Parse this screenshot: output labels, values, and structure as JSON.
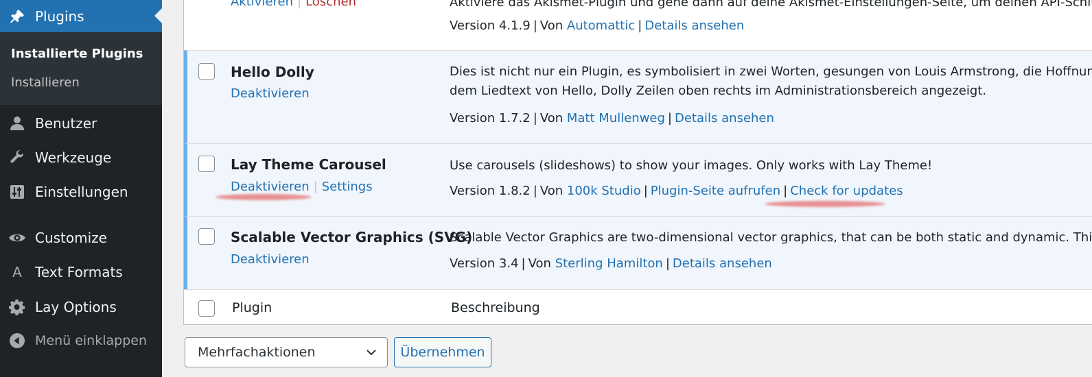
{
  "sidebar": {
    "active_menu": "Plugins",
    "submenu": [
      "Installierte Plugins",
      "Installieren"
    ],
    "items": [
      {
        "label": "Benutzer",
        "icon": "user-icon"
      },
      {
        "label": "Werkzeuge",
        "icon": "wrench-icon"
      },
      {
        "label": "Einstellungen",
        "icon": "settings-sliders-icon"
      },
      {
        "label": "Customize",
        "icon": "eye-icon"
      },
      {
        "label": "Text Formats",
        "icon": "letter-a-icon"
      },
      {
        "label": "Lay Options",
        "icon": "gear-icon"
      },
      {
        "label": "Menü einklappen",
        "icon": "collapse-arrow-icon"
      }
    ]
  },
  "plugins": [
    {
      "actions": [
        "Aktivieren",
        "Löschen"
      ],
      "desc": [
        "Aktiviere das Akismet-Plugin und gehe dann auf deine Akismet-Einstellungen-Seite, um deinen API-Schlüssel einzurichten."
      ],
      "version": "Version 4.1.9",
      "by": "Von",
      "author": "Automattic",
      "links": [
        "Details ansehen"
      ]
    },
    {
      "name": "Hello Dolly",
      "actions": [
        "Deaktivieren"
      ],
      "desc": [
        "Dies ist nicht nur ein Plugin, es symbolisiert in zwei Worten, gesungen von Louis Armstrong, die Hoffnung und die Begeisterung einer ganzen Generation. Wenn es aktiviert ist, wird zufällig eine Zeile aus",
        "dem Liedtext von Hello, Dolly Zeilen oben rechts im Administrationsbereich angezeigt."
      ],
      "version": "Version 1.7.2",
      "by": "Von",
      "author": "Matt Mullenweg",
      "links": [
        "Details ansehen"
      ]
    },
    {
      "name": "Lay Theme Carousel",
      "actions": [
        "Deaktivieren",
        "Settings"
      ],
      "desc": [
        "Use carousels (slideshows) to show your images. Only works with Lay Theme!"
      ],
      "version": "Version 1.8.2",
      "by": "Von",
      "author": "100k Studio",
      "links": [
        "Plugin-Seite aufrufen",
        "Check for updates"
      ]
    },
    {
      "name": "Scalable Vector Graphics (SVG)",
      "actions": [
        "Deaktivieren"
      ],
      "desc": [
        "Scalable Vector Graphics are two-dimensional vector graphics, that can be both static and dynamic. This plugin allows your to easily use them on your site."
      ],
      "version": "Version 3.4",
      "by": "Von",
      "author": "Sterling Hamilton",
      "links": [
        "Details ansehen"
      ]
    }
  ],
  "footer": {
    "col_plugin": "Plugin",
    "col_desc": "Beschreibung"
  },
  "bulk": {
    "select_value": "Mehrfachaktionen",
    "apply_label": "Übernehmen"
  },
  "colors": {
    "sidebar_bg": "#1d2327",
    "accent": "#2271b1",
    "active_row_bg": "#f0f6fc",
    "active_border": "#72aee6",
    "delete": "#b32d2e"
  }
}
